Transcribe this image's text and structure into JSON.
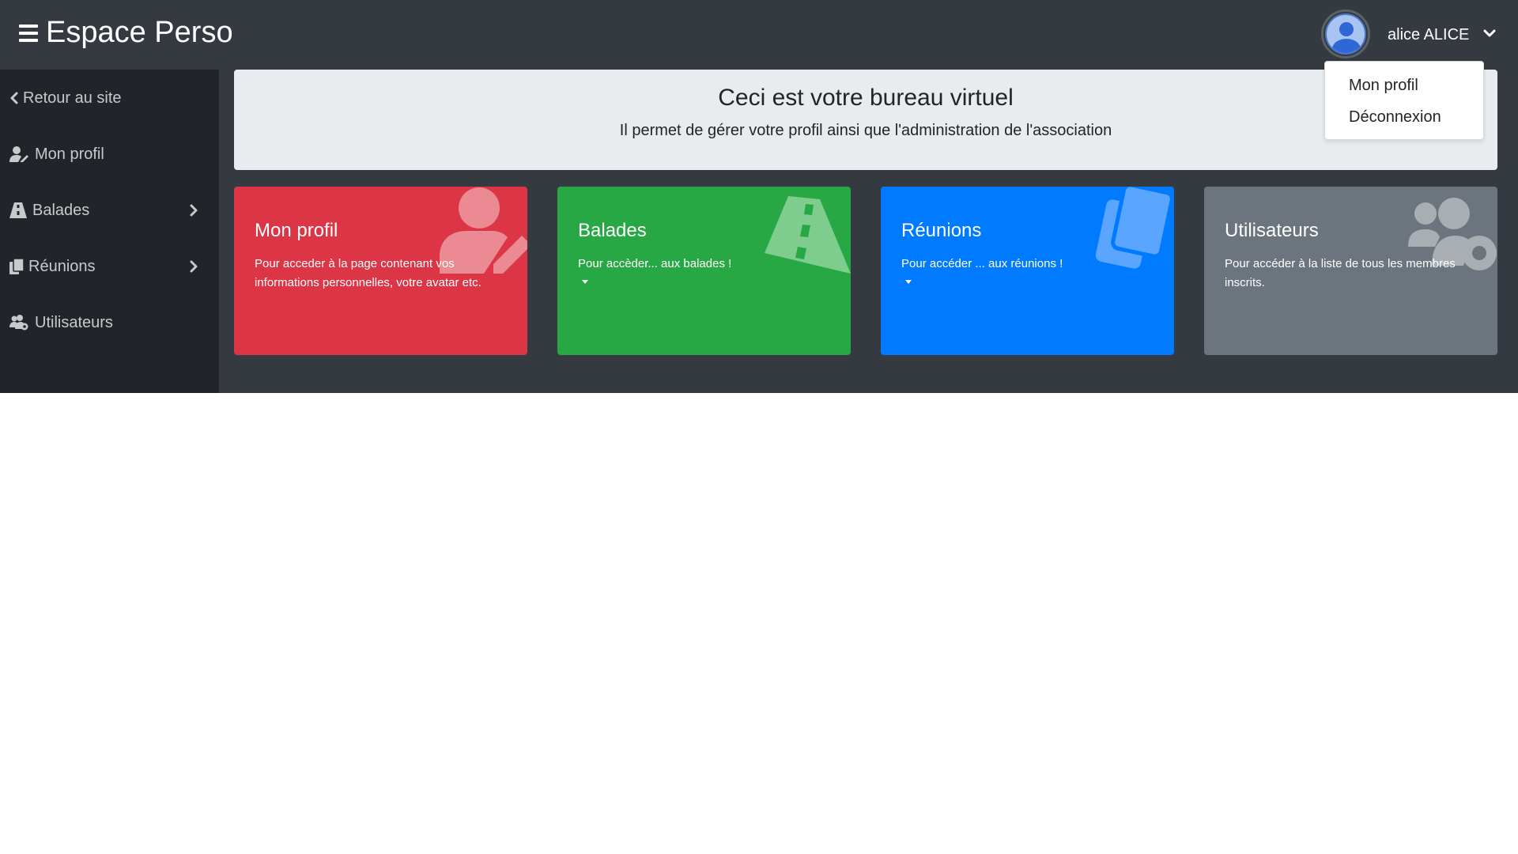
{
  "header": {
    "brand": "Espace Perso",
    "user_name": "alice ALICE",
    "user_menu": [
      "Mon profil",
      "Déconnexion"
    ]
  },
  "sidebar": {
    "items": [
      {
        "label": "Retour au site",
        "icon": "chevron-left-icon"
      },
      {
        "label": "Mon profil",
        "icon": "user-edit-icon"
      },
      {
        "label": "Balades",
        "icon": "road-icon",
        "has_submenu": true
      },
      {
        "label": "Réunions",
        "icon": "copy-icon",
        "has_submenu": true
      },
      {
        "label": "Utilisateurs",
        "icon": "users-cog-icon"
      }
    ]
  },
  "jumbotron": {
    "title": "Ceci est votre bureau virtuel",
    "subtitle": "Il permet de gérer votre profil ainsi que l'administration de l'association"
  },
  "cards": [
    {
      "title": "Mon profil",
      "description": "Pour acceder à la page contenant vos informations personnelles, votre avatar etc.",
      "color": "#dc3545",
      "icon": "user-edit-icon"
    },
    {
      "title": "Balades",
      "description": "Pour accèder... aux balades !",
      "color": "#28a745",
      "icon": "road-icon",
      "has_caret": true
    },
    {
      "title": "Réunions",
      "description": "Pour accéder ... aux réunions !",
      "color": "#007bff",
      "icon": "copy-icon",
      "has_caret": true
    },
    {
      "title": "Utilisateurs",
      "description": "Pour accéder à la liste de tous les membres inscrits.",
      "color": "#6c757d",
      "icon": "users-cog-icon"
    }
  ],
  "colors": {
    "topbar": "#343a40",
    "sidebar": "#212529",
    "jumbotron": "#e9ecef"
  }
}
